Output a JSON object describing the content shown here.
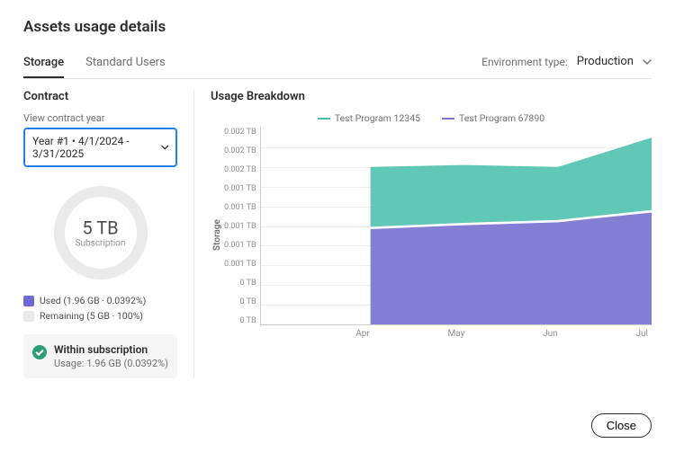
{
  "page_title": "Assets usage details",
  "tabs": [
    {
      "label": "Storage",
      "active": true
    },
    {
      "label": "Standard Users",
      "active": false
    }
  ],
  "environment": {
    "label": "Environment type:",
    "value": "Production"
  },
  "contract": {
    "title": "Contract",
    "year_label": "View contract year",
    "year_value": "Year #1  •  4/1/2024 - 3/31/2025",
    "subscription_value": "5 TB",
    "subscription_label": "Subscription",
    "legend": {
      "used": "Used (1.96 GB · 0.0392%)",
      "remaining": "Remaining (5 GB · 100%)"
    },
    "status": {
      "title": "Within subscription",
      "sub": "Usage: 1.96 GB (0.0392%)"
    }
  },
  "breakdown": {
    "title": "Usage Breakdown",
    "y_label": "Storage",
    "y_ticks": [
      "0.002 TB",
      "0.002 TB",
      "0.002 TB",
      "0.001 TB",
      "0.001 TB",
      "0.001 TB",
      "0.001 TB",
      "0.001 TB",
      "0 TB",
      "0 TB",
      "0 TB"
    ],
    "x_ticks": [
      "Apr",
      "May",
      "Jun",
      "Jul"
    ],
    "series": [
      {
        "name": "Test Program 12345",
        "color": "#4bbfad"
      },
      {
        "name": "Test Program 67890",
        "color": "#7a74d0"
      }
    ]
  },
  "close_label": "Close",
  "colors": {
    "accent_blue": "#2680eb",
    "series1": "#4bbfad",
    "series2": "#7a74d0",
    "status_green": "#2d9d78"
  },
  "chart_data": {
    "type": "area",
    "title": "Usage Breakdown",
    "xlabel": "",
    "ylabel": "Storage",
    "ylim": [
      0,
      0.002
    ],
    "categories": [
      "Apr",
      "May",
      "Jun",
      "Jul"
    ],
    "stacked": true,
    "series": [
      {
        "name": "Test Program 67890",
        "values": [
          0.00098,
          0.00102,
          0.00105,
          0.00115
        ],
        "color": "#7a74d0"
      },
      {
        "name": "Test Program 12345",
        "values": [
          0.00062,
          0.0006,
          0.00055,
          0.00075
        ],
        "color": "#4bbfad"
      }
    ]
  }
}
